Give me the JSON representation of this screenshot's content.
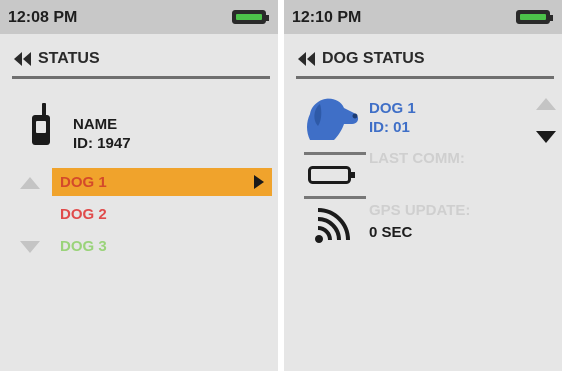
{
  "left_screen": {
    "time": "12:08 PM",
    "battery_icon": "battery-icon",
    "header": "STATUS",
    "owner": {
      "name": "NAME",
      "id": "ID: 1947"
    },
    "dogs": [
      {
        "label": "DOG 1",
        "color": "#d44a2a",
        "selected": true
      },
      {
        "label": "DOG 2",
        "color": "#e04b4b",
        "selected": false
      },
      {
        "label": "DOG 3",
        "color": "#9ad37a",
        "selected": false
      }
    ]
  },
  "right_screen": {
    "time": "12:10 PM",
    "battery_icon": "battery-icon",
    "header": "DOG STATUS",
    "dog_name": "DOG 1",
    "dog_id": "ID: 01",
    "last_comm_label": "LAST COMM:",
    "gps_label": "GPS UPDATE:",
    "gps_value": "0 SEC"
  },
  "colors": {
    "selection": "#f0a32c",
    "dog_blue": "#3f6fc7",
    "battery_green": "#4cc24a"
  }
}
